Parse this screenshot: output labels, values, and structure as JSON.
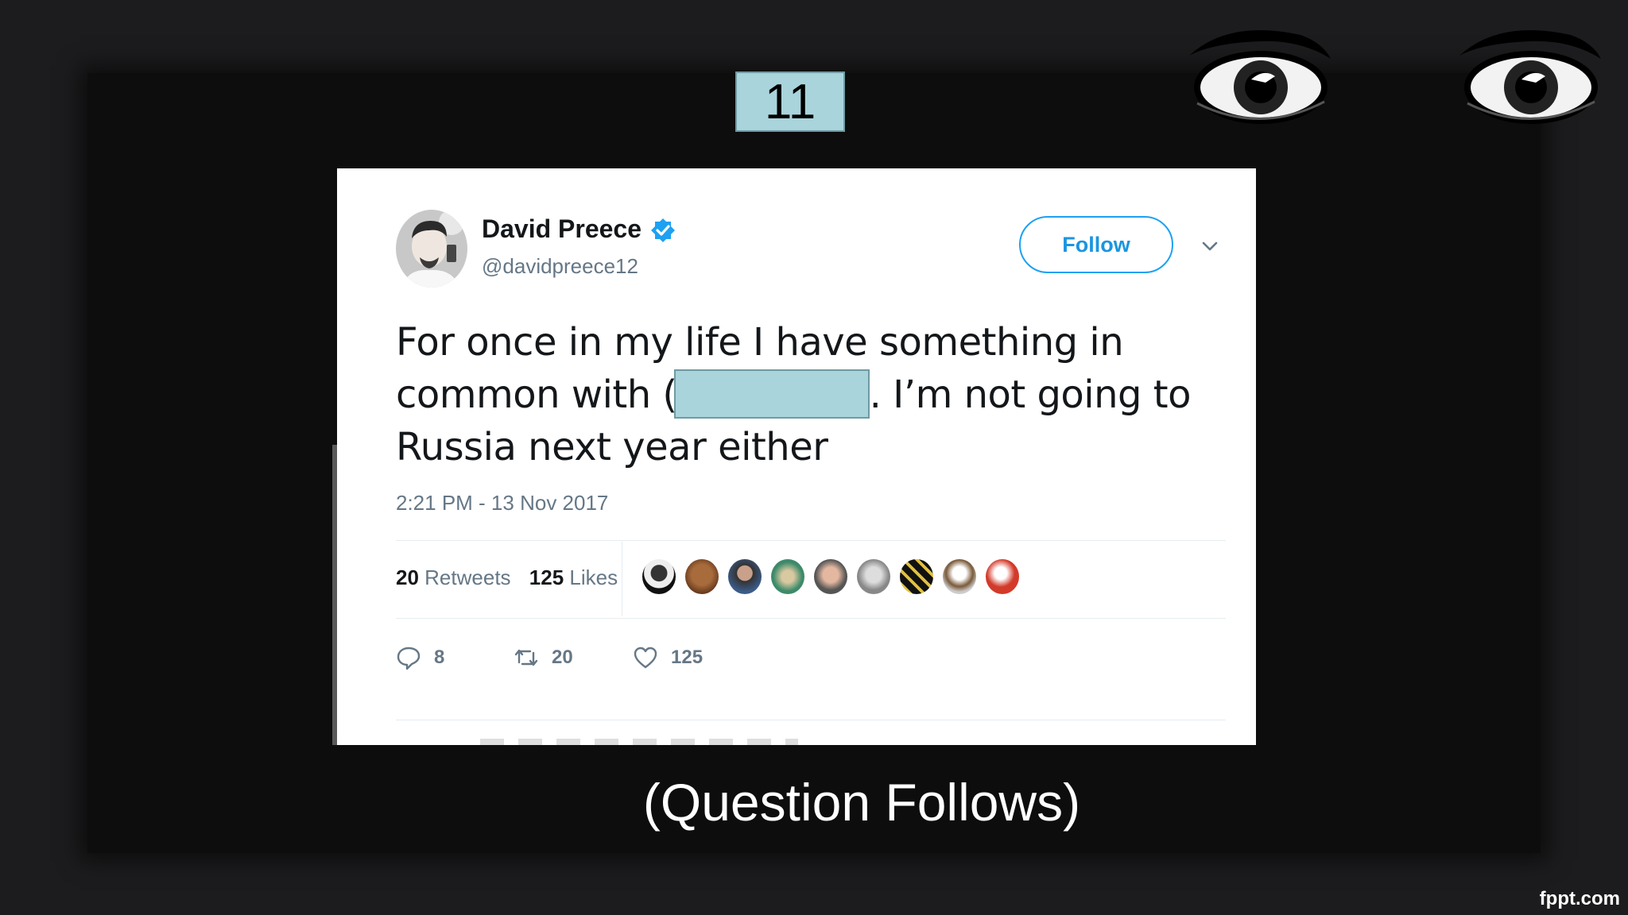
{
  "slide": {
    "number": "11",
    "caption": "(Question Follows)",
    "watermark": "fppt.com"
  },
  "tweet": {
    "display_name": "David Preece",
    "handle": "@davidpreece12",
    "verified": true,
    "follow_label": "Follow",
    "text_part1": "For once in my life I have something in common with (",
    "text_part2": ". I’m not going to Russia next year either",
    "timestamp": "2:21 PM - 13 Nov 2017",
    "retweets_count": "20",
    "retweets_label": "Retweets",
    "likes_count": "125",
    "likes_label": "Likes",
    "liker_avatar_count": 9,
    "actions": {
      "reply_count": "8",
      "retweet_count": "20",
      "like_count": "125"
    },
    "colors": {
      "brand_blue": "#1da1f2",
      "text_secondary": "#657786",
      "redaction": "#a9d4dc"
    }
  },
  "icons": [
    "eye-icon",
    "verified-badge-icon",
    "chevron-down-icon",
    "reply-icon",
    "retweet-icon",
    "heart-icon"
  ]
}
